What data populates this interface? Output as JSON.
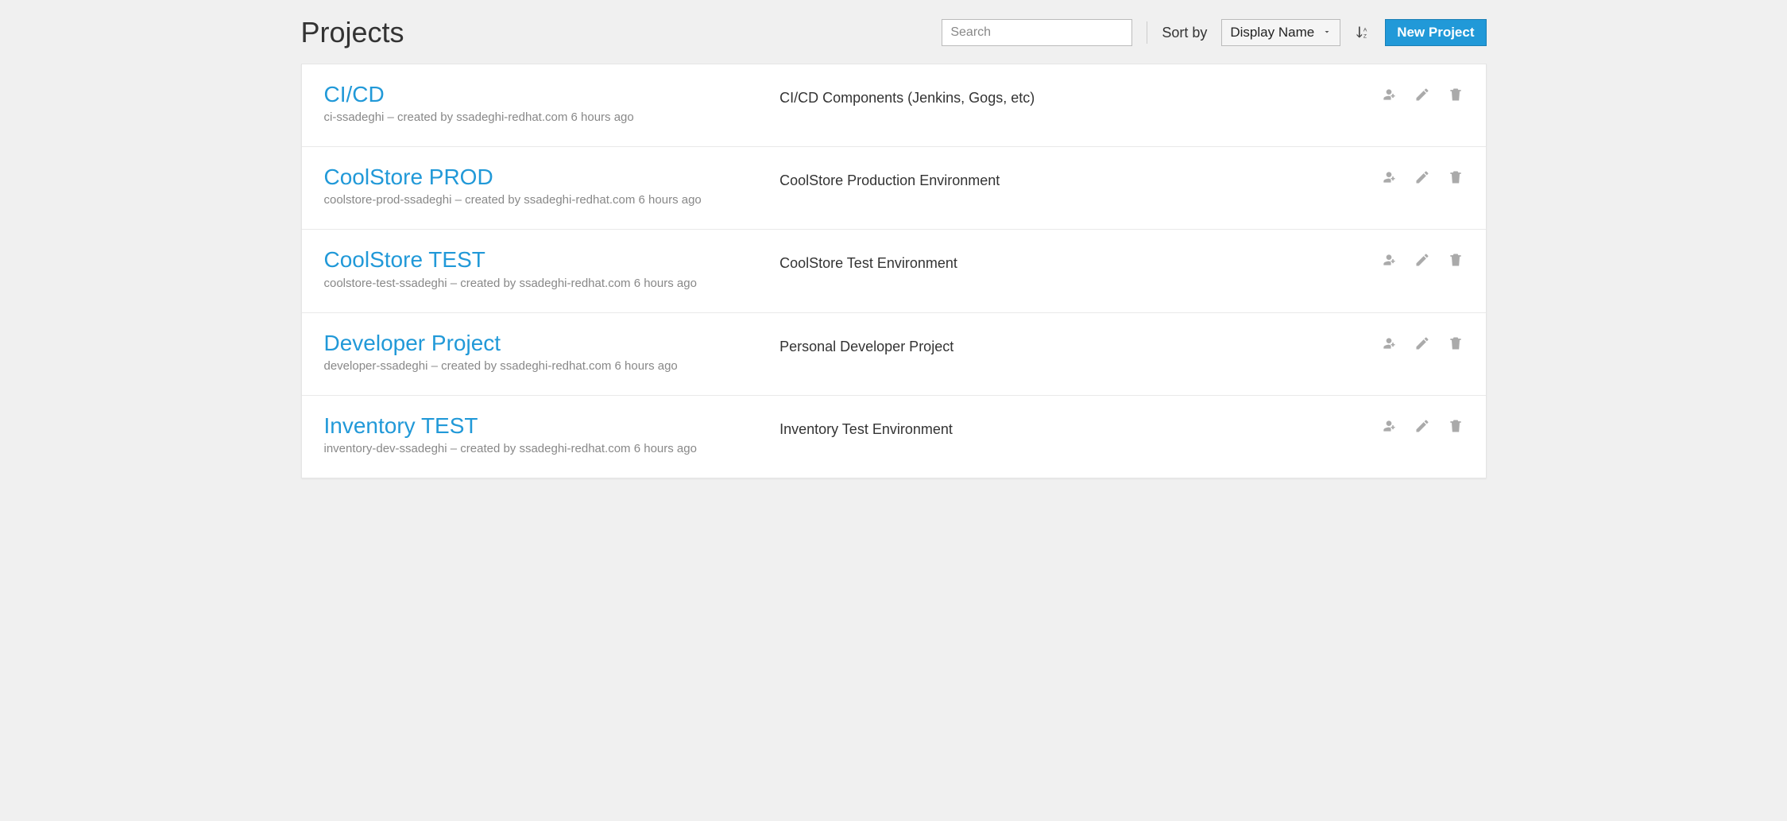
{
  "page_title": "Projects",
  "search": {
    "placeholder": "Search",
    "value": ""
  },
  "sort": {
    "label": "Sort by",
    "selected": "Display Name"
  },
  "new_button": "New Project",
  "projects": [
    {
      "title": "CI/CD",
      "meta": "ci-ssadeghi – created by ssadeghi-redhat.com 6 hours ago",
      "description": "CI/CD Components (Jenkins, Gogs, etc)"
    },
    {
      "title": "CoolStore PROD",
      "meta": "coolstore-prod-ssadeghi – created by ssadeghi-redhat.com 6 hours ago",
      "description": "CoolStore Production Environment"
    },
    {
      "title": "CoolStore TEST",
      "meta": "coolstore-test-ssadeghi – created by ssadeghi-redhat.com 6 hours ago",
      "description": "CoolStore Test Environment"
    },
    {
      "title": "Developer Project",
      "meta": "developer-ssadeghi – created by ssadeghi-redhat.com 6 hours ago",
      "description": "Personal Developer Project"
    },
    {
      "title": "Inventory TEST",
      "meta": "inventory-dev-ssadeghi – created by ssadeghi-redhat.com 6 hours ago",
      "description": "Inventory Test Environment"
    }
  ]
}
